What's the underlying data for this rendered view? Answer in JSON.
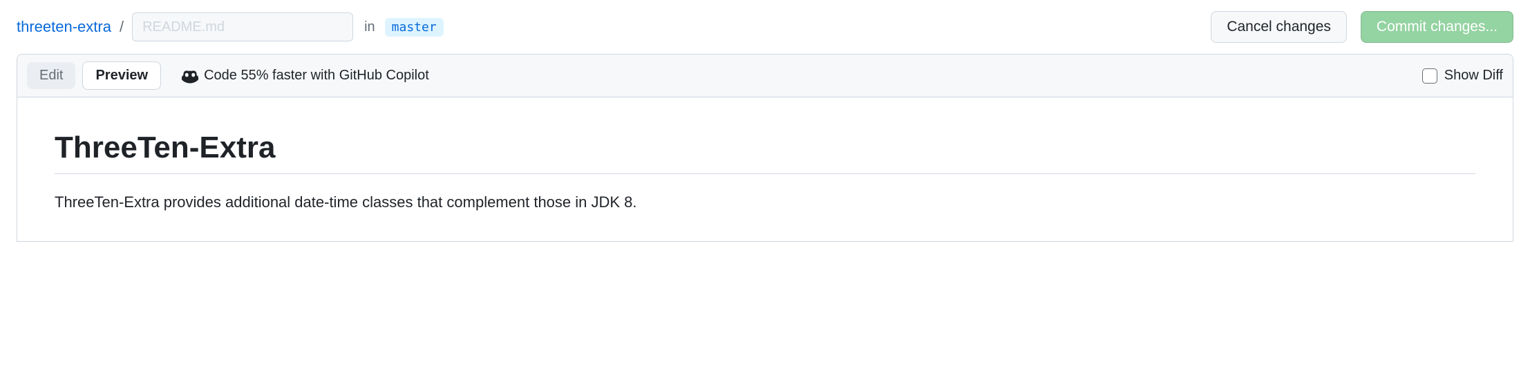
{
  "breadcrumb": {
    "repo": "threeten-extra",
    "separator": "/",
    "filename_placeholder": "README.md",
    "filename_value": "",
    "in_label": "in",
    "branch": "master"
  },
  "actions": {
    "cancel_label": "Cancel changes",
    "commit_label": "Commit changes..."
  },
  "tabs": {
    "edit_label": "Edit",
    "preview_label": "Preview"
  },
  "copilot": {
    "text": "Code 55% faster with GitHub Copilot"
  },
  "diff": {
    "label": "Show Diff"
  },
  "preview": {
    "heading": "ThreeTen-Extra",
    "paragraph": "ThreeTen-Extra provides additional date-time classes that complement those in JDK 8."
  }
}
